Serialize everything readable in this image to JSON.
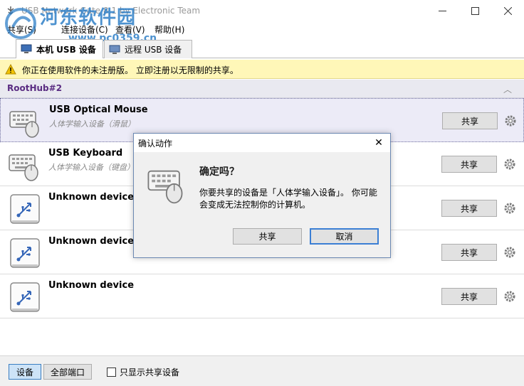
{
  "window": {
    "title": "USB Network Gate 8.1 by Electronic Team",
    "controls": {
      "minimize": "—",
      "maximize": "☐",
      "close": "✕"
    }
  },
  "watermark": {
    "site_name": "河东软件园",
    "url": "www.pc0359.cn"
  },
  "menu": [
    {
      "label": "共享(S)"
    },
    {
      "label": "连接设备(C)"
    },
    {
      "label": "查看(V)"
    },
    {
      "label": "帮助(H)"
    }
  ],
  "tabs": [
    {
      "label": "本机 USB 设备",
      "active": true
    },
    {
      "label": "远程 USB 设备",
      "active": false
    }
  ],
  "warning": {
    "text": "你正在使用软件的未注册版。 立即注册以无限制的共享。"
  },
  "hub": {
    "label": "RootHub#2",
    "collapse_glyph": "︿"
  },
  "devices": [
    {
      "name": "USB Optical Mouse",
      "subtitle": "人体学输入设备（滑鼠）",
      "icon": "keyboard-mouse-icon",
      "share_label": "共享",
      "selected": true
    },
    {
      "name": "USB Keyboard",
      "subtitle": "人体学输入设备（键盘）",
      "icon": "keyboard-mouse-icon",
      "share_label": "共享",
      "selected": false
    },
    {
      "name": "Unknown device",
      "subtitle": "",
      "icon": "usb-device-icon",
      "share_label": "共享",
      "selected": false
    },
    {
      "name": "Unknown device",
      "subtitle": "",
      "icon": "usb-device-icon",
      "share_label": "共享",
      "selected": false
    },
    {
      "name": "Unknown device",
      "subtitle": "",
      "icon": "usb-device-icon",
      "share_label": "共享",
      "selected": false
    }
  ],
  "bottom": {
    "devices_button": "设备",
    "all_ports_button": "全部端口",
    "only_shared_checkbox": "只显示共享设备",
    "only_shared_checked": false
  },
  "dialog": {
    "title": "确认动作",
    "close_glyph": "✕",
    "heading": "确定吗？",
    "body": "你要共享的设备是「人体学输入设备」。 你可能会变成无法控制你的计算机。",
    "ok_label": "共享",
    "cancel_label": "取消"
  },
  "colors": {
    "warning_bg": "#fff7b8",
    "hub_label": "#5a2c82",
    "selected_row_bg": "#ecebf7",
    "dialog_focus_border": "#3b7fd4",
    "watermark_blue": "#2f7fc7"
  }
}
